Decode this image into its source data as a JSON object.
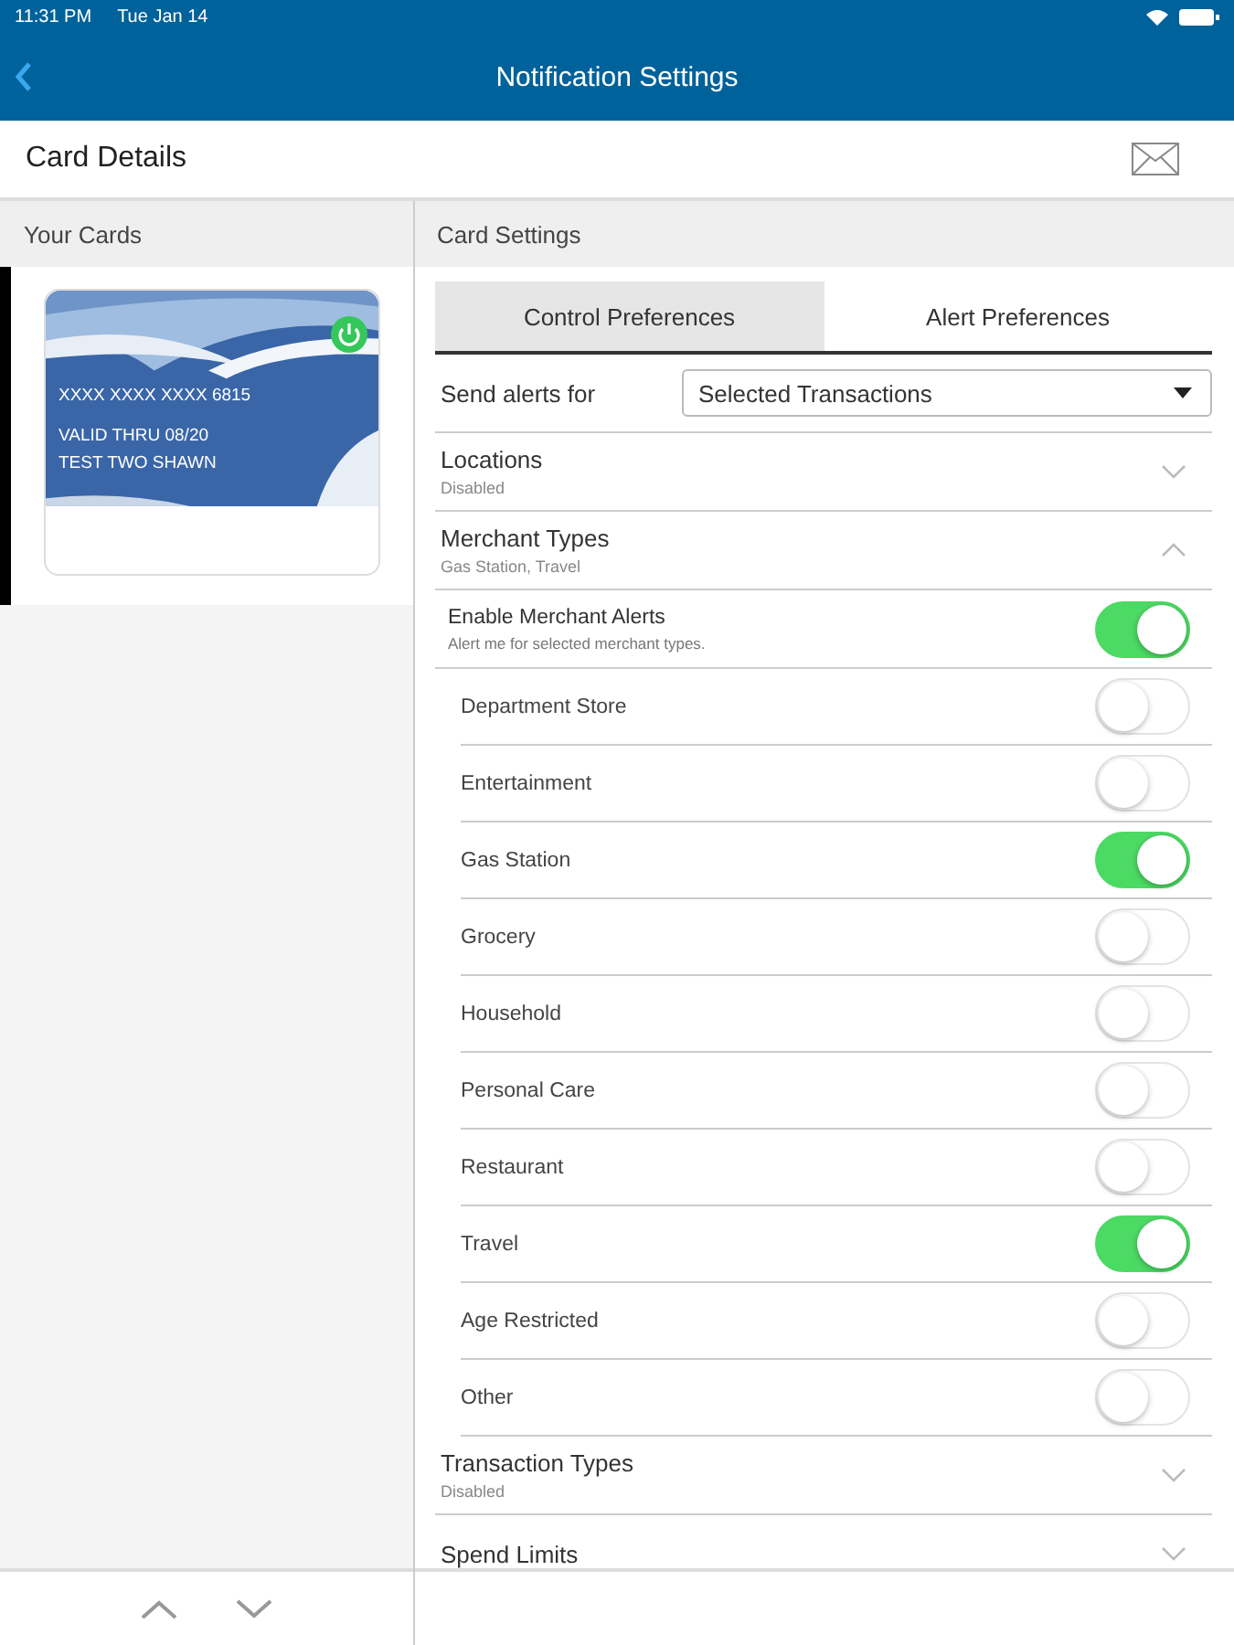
{
  "status_bar": {
    "time": "11:31 PM",
    "date": "Tue Jan 14"
  },
  "nav": {
    "title": "Notification Settings"
  },
  "header": {
    "title": "Card Details"
  },
  "left": {
    "title": "Your Cards",
    "card": {
      "selected": true,
      "power_on": true,
      "number": "XXXX XXXX XXXX 6815",
      "valid": "VALID THRU 08/20",
      "name": "TEST TWO SHAWN"
    }
  },
  "right": {
    "title": "Card Settings",
    "tabs": [
      {
        "label": "Control Preferences",
        "selected": false
      },
      {
        "label": "Alert Preferences",
        "selected": true
      }
    ],
    "send_alerts": {
      "label": "Send alerts for",
      "value": "Selected Transactions"
    },
    "sections": [
      {
        "title": "Locations",
        "subtitle": "Disabled",
        "expanded": false
      },
      {
        "title": "Merchant Types",
        "subtitle": "Gas Station, Travel",
        "expanded": true,
        "master": {
          "label": "Enable Merchant Alerts",
          "hint": "Alert me for selected merchant types.",
          "on": true
        },
        "items": [
          {
            "label": "Department Store",
            "on": false
          },
          {
            "label": "Entertainment",
            "on": false
          },
          {
            "label": "Gas Station",
            "on": true
          },
          {
            "label": "Grocery",
            "on": false
          },
          {
            "label": "Household",
            "on": false
          },
          {
            "label": "Personal Care",
            "on": false
          },
          {
            "label": "Restaurant",
            "on": false
          },
          {
            "label": "Travel",
            "on": true
          },
          {
            "label": "Age Restricted",
            "on": false
          },
          {
            "label": "Other",
            "on": false
          }
        ]
      },
      {
        "title": "Transaction Types",
        "subtitle": "Disabled",
        "expanded": false
      },
      {
        "title": "Spend Limits",
        "expanded": false
      }
    ]
  }
}
